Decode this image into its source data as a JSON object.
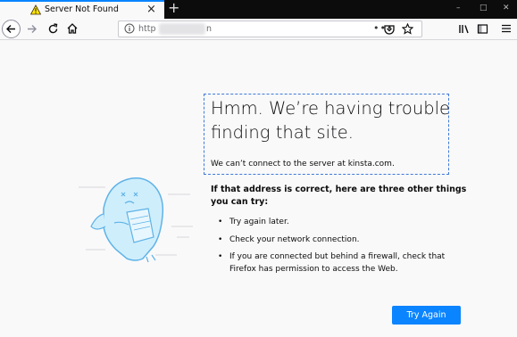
{
  "tab": {
    "title": "Server Not Found",
    "close_glyph": "×",
    "new_tab_glyph": "+"
  },
  "window_controls": {
    "minimize": "–",
    "maximize": "□",
    "close": "✕"
  },
  "nav": {
    "url_prefix": "http",
    "url_suffix": "n",
    "page_actions_glyph": "•••"
  },
  "error": {
    "title": "Hmm. We’re having trouble finding that site.",
    "description": "We can’t connect to the server at kinsta.com.",
    "suggest_heading": "If that address is correct, here are three other things you can try:",
    "suggestions": [
      "Try again later.",
      "Check your network connection.",
      "If you are connected but behind a firewall, check that Firefox has permission to access the Web."
    ],
    "button_label": "Try Again"
  },
  "colors": {
    "accent": "#0a84ff",
    "tabstrip": "#0c0c0d",
    "highlight": "#3f7ad8"
  },
  "icons": [
    "warning-icon",
    "back-icon",
    "forward-icon",
    "reload-icon",
    "home-icon",
    "info-icon",
    "pocket-icon",
    "bookmark-star-icon",
    "library-icon",
    "sidebar-icon",
    "menu-icon"
  ]
}
